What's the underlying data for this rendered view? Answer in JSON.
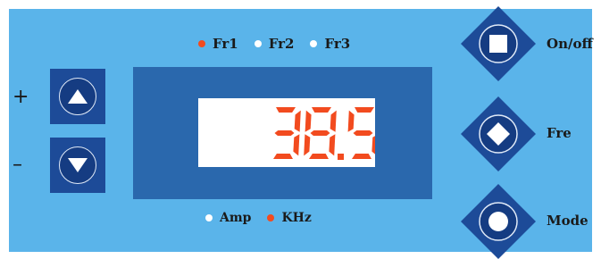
{
  "frequency_indicators": [
    {
      "label": "Fr1",
      "active": true
    },
    {
      "label": "Fr2",
      "active": false
    },
    {
      "label": "Fr3",
      "active": false
    }
  ],
  "unit_indicators": [
    {
      "label": "Amp",
      "active": false
    },
    {
      "label": "KHz",
      "active": true
    }
  ],
  "display": {
    "value": "38.5"
  },
  "adjust": {
    "plus_label": "+",
    "minus_label": "–"
  },
  "right_buttons": {
    "onoff_label": "On/off",
    "fre_label": "Fre",
    "mode_label": "Mode"
  },
  "colors": {
    "panel": "#5ab4ea",
    "button": "#1d4b98",
    "display_frame": "#2a68ad",
    "indicator_on": "#f24b1f",
    "indicator_off": "#ffffff",
    "segment_on": "#f24b1f"
  },
  "icons": {
    "up": "triangle-up-icon",
    "down": "triangle-down-icon",
    "onoff": "square-icon",
    "fre": "diamond-icon",
    "mode": "circle-icon"
  }
}
